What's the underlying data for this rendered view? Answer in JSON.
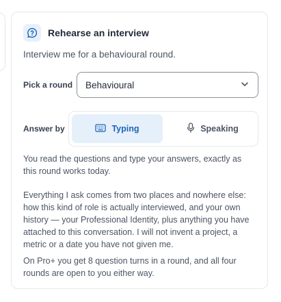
{
  "card": {
    "title": "Rehearse an interview",
    "subtitle": "Interview me for a behavioural round."
  },
  "round": {
    "label": "Pick a round",
    "selected": "Behavioural"
  },
  "answer": {
    "label": "Answer by",
    "options": [
      {
        "label": "Typing",
        "icon": "keyboard-icon",
        "selected": true
      },
      {
        "label": "Speaking",
        "icon": "microphone-icon",
        "selected": false
      }
    ]
  },
  "description": {
    "mode_note": "You read the questions and type your answers, exactly as this round works today.",
    "sources_note": "Everything I ask comes from two places and nowhere else: how this kind of role is actually interviewed, and your own history — your Professional Identity, plus anything you have attached to this conversation. I will not invent a project, a metric or a date you have not given me.",
    "plan_note": "On Pro+ you get 8 question turns in a round, and all four rounds are open to you either way."
  },
  "colors": {
    "accent": "#1d64b6",
    "accent_bg": "#e6f0fb",
    "border": "#e6e8ec"
  }
}
